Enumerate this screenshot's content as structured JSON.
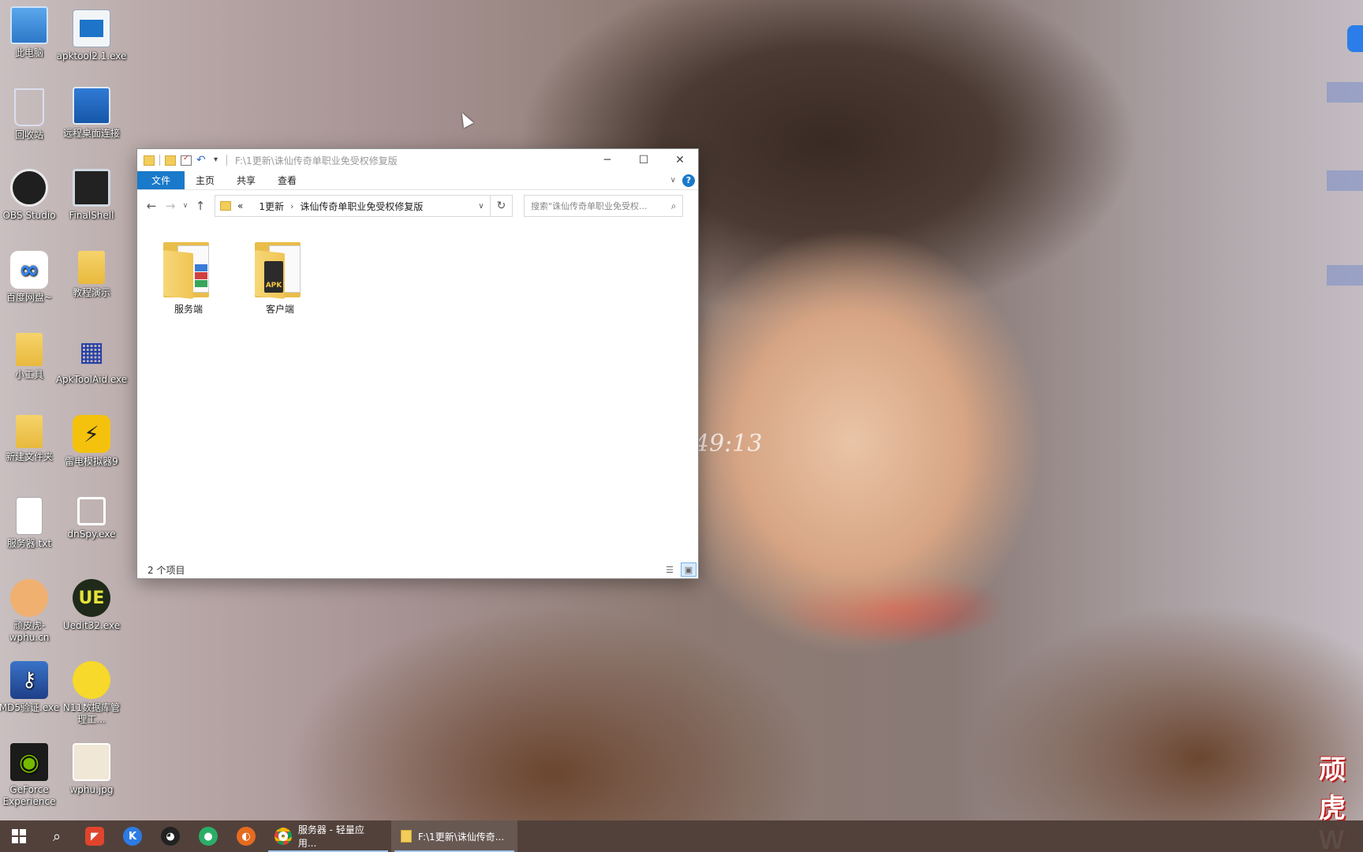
{
  "desktop": {
    "icons": [
      {
        "label": "此电脑",
        "icon": "computer-icon"
      },
      {
        "label": "apktool2.1.exe",
        "icon": "exe-icon"
      },
      {
        "label": "回收站",
        "icon": "recycle-bin-icon"
      },
      {
        "label": "远程桌面连接",
        "icon": "remote-desktop-icon"
      },
      {
        "label": "OBS Studio",
        "icon": "obs-icon"
      },
      {
        "label": "FinalShell",
        "icon": "finalshell-icon"
      },
      {
        "label": "百度网盘~",
        "icon": "baidu-netdisk-icon"
      },
      {
        "label": "教程演示",
        "icon": "folder-icon"
      },
      {
        "label": "小工具",
        "icon": "folder-icon"
      },
      {
        "label": "ApkToolAid.exe",
        "icon": "apktoolaid-icon"
      },
      {
        "label": "新建文件夹",
        "icon": "folder-icon"
      },
      {
        "label": "雷电模拟器9",
        "icon": "ldplayer-icon"
      },
      {
        "label": "服务器.txt",
        "icon": "text-file-icon"
      },
      {
        "label": "dnSpy.exe",
        "icon": "dnspy-icon"
      },
      {
        "label": "顽皮虎-wphu.cn",
        "icon": "tiger-icon"
      },
      {
        "label": "Uedit32.exe",
        "icon": "uedit-icon"
      },
      {
        "label": "MD5验证.exe",
        "icon": "key-icon"
      },
      {
        "label": "N11数据库管理工...",
        "icon": "n11-icon"
      },
      {
        "label": "GeForce Experience",
        "icon": "nvidia-icon"
      },
      {
        "label": "wphu.jpg",
        "icon": "image-icon"
      }
    ],
    "clock_overlay": "49:13",
    "watermark": "顽虎 W"
  },
  "explorer": {
    "title": "F:\\1更新\\诛仙传奇单职业免受权修复版",
    "ribbon_tabs": [
      "文件",
      "主页",
      "共享",
      "查看"
    ],
    "help_label": "?",
    "address": {
      "prefix": "«",
      "crumbs": [
        "1更新",
        "诛仙传奇单职业免受权修复版"
      ]
    },
    "search_placeholder": "搜索\"诛仙传奇单职业免受权...",
    "items": [
      {
        "name": "服务端",
        "icon": "folder-icon"
      },
      {
        "name": "客户端",
        "icon": "folder-apk-icon",
        "badge": "APK"
      }
    ],
    "status": "2 个项目"
  },
  "taskbar": {
    "apps": [
      {
        "label": "服务器 - 轻量应用...",
        "icon": "chrome-icon"
      },
      {
        "label": "F:\\1更新\\诛仙传奇...",
        "icon": "folder-icon"
      }
    ],
    "pinned": [
      "start-icon",
      "search-icon",
      "wps-icon",
      "k-icon",
      "qq-icon",
      "wechat-icon",
      "firefox-icon"
    ]
  }
}
